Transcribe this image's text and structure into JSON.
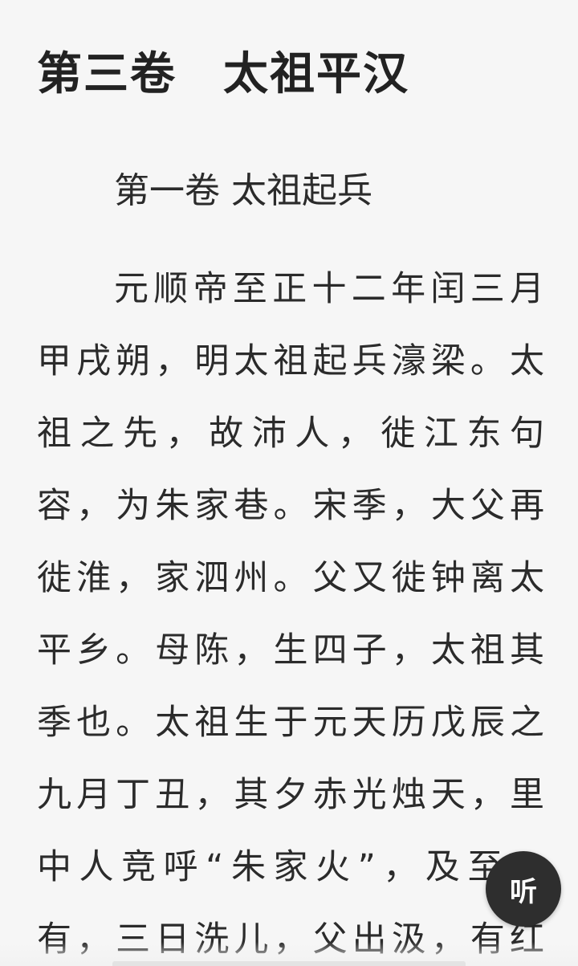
{
  "book_title": "第三卷　太祖平汉",
  "chapter_title": "第一卷 太祖起兵",
  "paragraph_lines": [
    "元顺帝至正十二年闰三月",
    "甲戌朔，明太祖起兵濠梁。太",
    "祖之先，故沛人，徙江东句",
    "容，为朱家巷。宋季，大父再",
    "徙淮，家泗州。父又徙钟离太",
    "平乡。母陈，生四子，太祖其",
    "季也。太祖生于元天历戊辰之",
    "九月丁丑，其夕赤光烛天，里",
    "中人竞呼“朱家火”，及至，",
    "有，三日洗儿，父出汲，有红"
  ],
  "listen_button": {
    "label": "听",
    "icon": "listen-icon"
  }
}
